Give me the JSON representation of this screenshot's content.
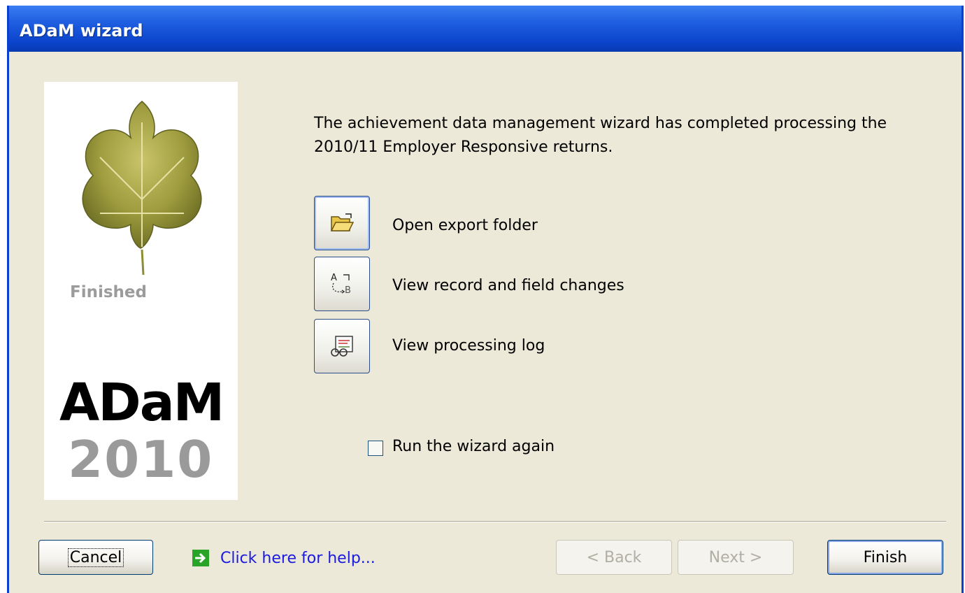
{
  "window": {
    "title": "ADaM wizard"
  },
  "sidebar": {
    "status": "Finished",
    "brand_name": "ADaM",
    "brand_year": "2010"
  },
  "main": {
    "message": "The achievement data management wizard has completed processing the 2010/11 Employer Responsive returns.",
    "actions": [
      {
        "label": "Open export folder",
        "icon": "open-folder-icon"
      },
      {
        "label": "View record and field changes",
        "icon": "compare-changes-icon"
      },
      {
        "label": "View processing log",
        "icon": "processing-log-icon"
      }
    ],
    "run_again": {
      "label": "Run the wizard again",
      "checked": false
    }
  },
  "footer": {
    "cancel": "Cancel",
    "help": "Click here for help...",
    "back": "< Back",
    "next": "Next >",
    "finish": "Finish"
  },
  "colors": {
    "titlebar": "#0a44cc",
    "dialog_bg": "#ece9d8",
    "link": "#1a1ae0",
    "help_icon": "#2aa329"
  }
}
